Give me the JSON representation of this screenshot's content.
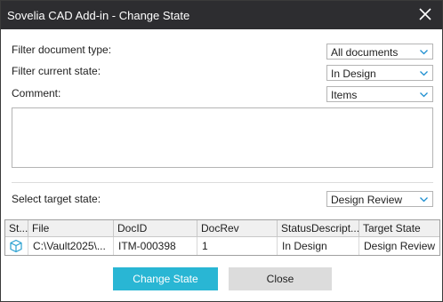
{
  "window": {
    "title": "Sovelia CAD Add-in - Change State"
  },
  "filters": {
    "doc_type_label": "Filter document type:",
    "doc_type_value": "All documents",
    "state_label": "Filter current state:",
    "state_value": "In Design",
    "comment_label": "Comment:",
    "comment_value": "Items"
  },
  "target": {
    "label": "Select target state:",
    "value": "Design Review"
  },
  "grid": {
    "columns": [
      "St...",
      "File",
      "DocID",
      "DocRev",
      "StatusDescript...",
      "Target State"
    ],
    "rows": [
      {
        "file": "C:\\Vault2025\\...",
        "docid": "ITM-000398",
        "docrev": "1",
        "status": "In Design",
        "target": "Design Review"
      }
    ]
  },
  "buttons": {
    "change": "Change State",
    "close": "Close"
  },
  "colors": {
    "accent": "#29b6d4",
    "titlebar": "#2d2d30",
    "icon": "#29a0d0"
  }
}
